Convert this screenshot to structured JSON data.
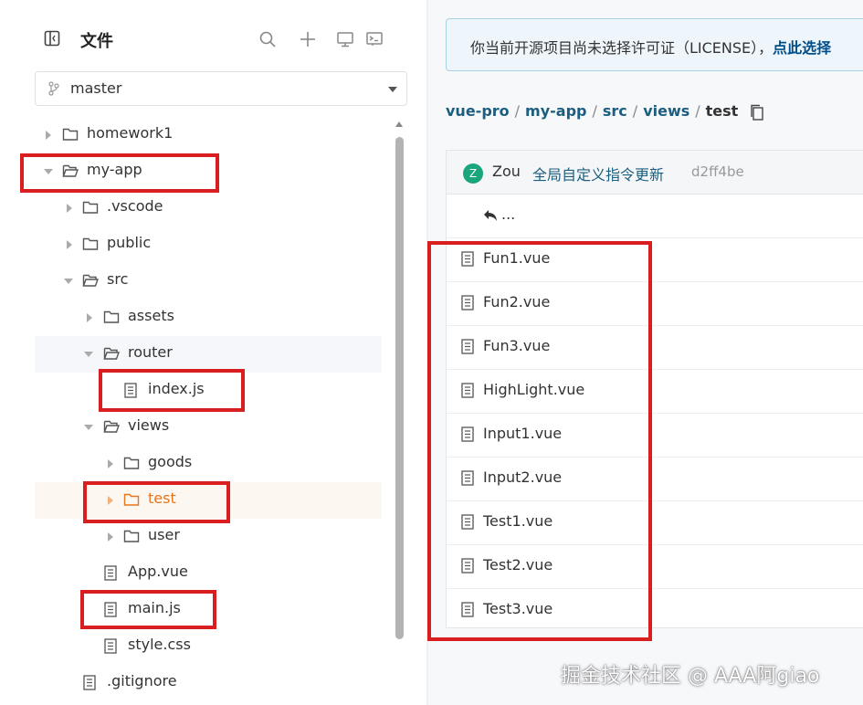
{
  "sidebar": {
    "title": "文件",
    "branch": "master",
    "tree": [
      {
        "label": "homework1",
        "type": "folder",
        "expanded": false
      },
      {
        "label": "my-app",
        "type": "folder",
        "expanded": true
      },
      {
        "label": ".vscode",
        "type": "folder",
        "expanded": false
      },
      {
        "label": "public",
        "type": "folder",
        "expanded": false
      },
      {
        "label": "src",
        "type": "folder",
        "expanded": true
      },
      {
        "label": "assets",
        "type": "folder",
        "expanded": false
      },
      {
        "label": "router",
        "type": "folder",
        "expanded": true
      },
      {
        "label": "index.js",
        "type": "file"
      },
      {
        "label": "views",
        "type": "folder",
        "expanded": true
      },
      {
        "label": "goods",
        "type": "folder",
        "expanded": false
      },
      {
        "label": "test",
        "type": "folder",
        "expanded": false,
        "active": true
      },
      {
        "label": "user",
        "type": "folder",
        "expanded": false
      },
      {
        "label": "App.vue",
        "type": "file"
      },
      {
        "label": "main.js",
        "type": "file"
      },
      {
        "label": "style.css",
        "type": "file"
      },
      {
        "label": ".gitignore",
        "type": "file"
      }
    ]
  },
  "notice": {
    "text": "你当前开源项目尚未选择许可证（LICENSE），",
    "link": "点此选择"
  },
  "breadcrumb": {
    "items": [
      "vue-pro",
      "my-app",
      "src",
      "views",
      "test"
    ]
  },
  "commit": {
    "avatar_letter": "Z",
    "author": "Zou",
    "message": "全局自定义指令更新",
    "hash": "d2ff4be"
  },
  "files": {
    "back_label": "...",
    "items": [
      "Fun1.vue",
      "Fun2.vue",
      "Fun3.vue",
      "HighLight.vue",
      "Input1.vue",
      "Input2.vue",
      "Test1.vue",
      "Test2.vue",
      "Test3.vue"
    ]
  },
  "watermark": "掘金技术社区 @ AAA阿giao",
  "colors": {
    "highlight_box": "#d81e1e",
    "active_folder": "#e8761c",
    "link": "#1b5e7f"
  }
}
